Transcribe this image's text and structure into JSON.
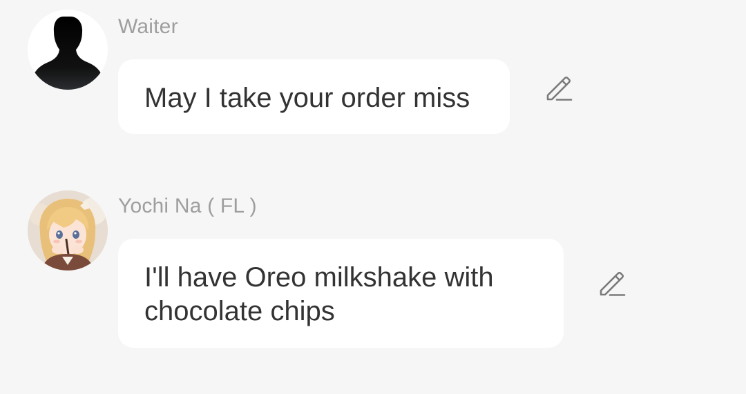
{
  "messages": [
    {
      "sender": "Waiter",
      "avatar": "silhouette-avatar",
      "text": "May I take your order miss",
      "action_icon": "pencil-edit-icon"
    },
    {
      "sender": "Yochi Na ( FL )",
      "avatar": "anime-girl-avatar",
      "text": "I'll have Oreo milkshake with chocolate chips",
      "action_icon": "pencil-edit-icon"
    }
  ],
  "colors": {
    "background": "#f6f6f6",
    "bubble": "#ffffff",
    "sender_name": "#9e9e9e",
    "message_text": "#333333",
    "icon": "#7a7a7a"
  }
}
